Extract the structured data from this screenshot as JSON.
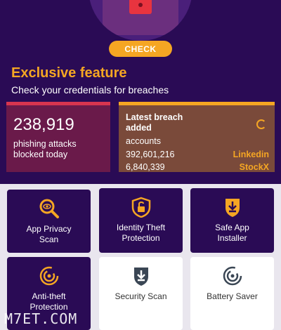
{
  "hero": {
    "check_label": "CHECK"
  },
  "feature": {
    "title": "Exclusive feature",
    "subtitle": "Check your credentials for breaches"
  },
  "phishing": {
    "count": "238,919",
    "label": "phishing attacks blocked today"
  },
  "breach": {
    "title": "Latest breach added",
    "accounts_label": "accounts",
    "rows": [
      {
        "count": "392,601,216",
        "source": "Linkedin"
      },
      {
        "count": "6,840,339",
        "source": "StockX"
      }
    ]
  },
  "tiles": [
    {
      "label": "App Privacy Scan",
      "icon": "magnifier-eye-icon"
    },
    {
      "label": "Identity Theft Protection",
      "icon": "shield-unlock-icon"
    },
    {
      "label": "Safe App Installer",
      "icon": "shield-download-icon"
    },
    {
      "label": "Anti-theft Protection",
      "icon": "radar-icon"
    },
    {
      "label": "Security Scan",
      "icon": "shield-scan-icon"
    },
    {
      "label": "Battery Saver",
      "icon": "battery-radar-icon"
    }
  ],
  "watermark": {
    "text": "M7ET.COM"
  },
  "colors": {
    "background": "#2a0b55",
    "accent": "#f5a623",
    "phish_card": "#6a1a4a",
    "breach_card": "#7a4a3a",
    "alert": "#d8354f"
  }
}
